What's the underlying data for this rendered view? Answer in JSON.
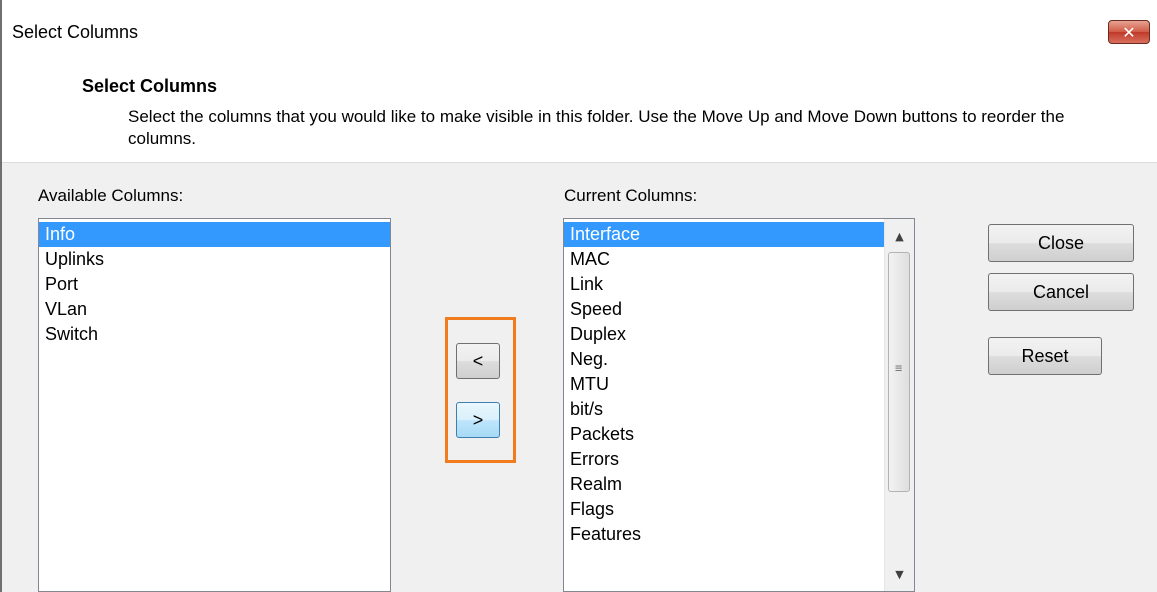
{
  "window": {
    "title": "Select Columns",
    "close_glyph": "✕"
  },
  "header": {
    "title": "Select Columns",
    "description": "Select the columns that you would like to make visible in this folder. Use the Move Up and Move Down buttons to reorder the columns."
  },
  "available": {
    "label": "Available Columns:",
    "items": [
      "Info",
      "Uplinks",
      "Port",
      "VLan",
      "Switch"
    ],
    "selected_index": 0
  },
  "current": {
    "label": "Current Columns:",
    "items": [
      "Interface",
      "MAC",
      "Link",
      "Speed",
      "Duplex",
      "Neg.",
      "MTU",
      "bit/s",
      "Packets",
      "Errors",
      "Realm",
      "Flags",
      "Features"
    ],
    "selected_index": 0
  },
  "transfer": {
    "move_left_label": "<",
    "move_right_label": ">"
  },
  "buttons": {
    "close_label": "Close",
    "cancel_label": "Cancel",
    "reset_label": "Reset"
  },
  "scrollbar": {
    "up_glyph": "▲",
    "down_glyph": "▼",
    "grip_glyph": "≡"
  },
  "colors": {
    "selection": "#3399ff",
    "highlight": "#f07c1e"
  }
}
